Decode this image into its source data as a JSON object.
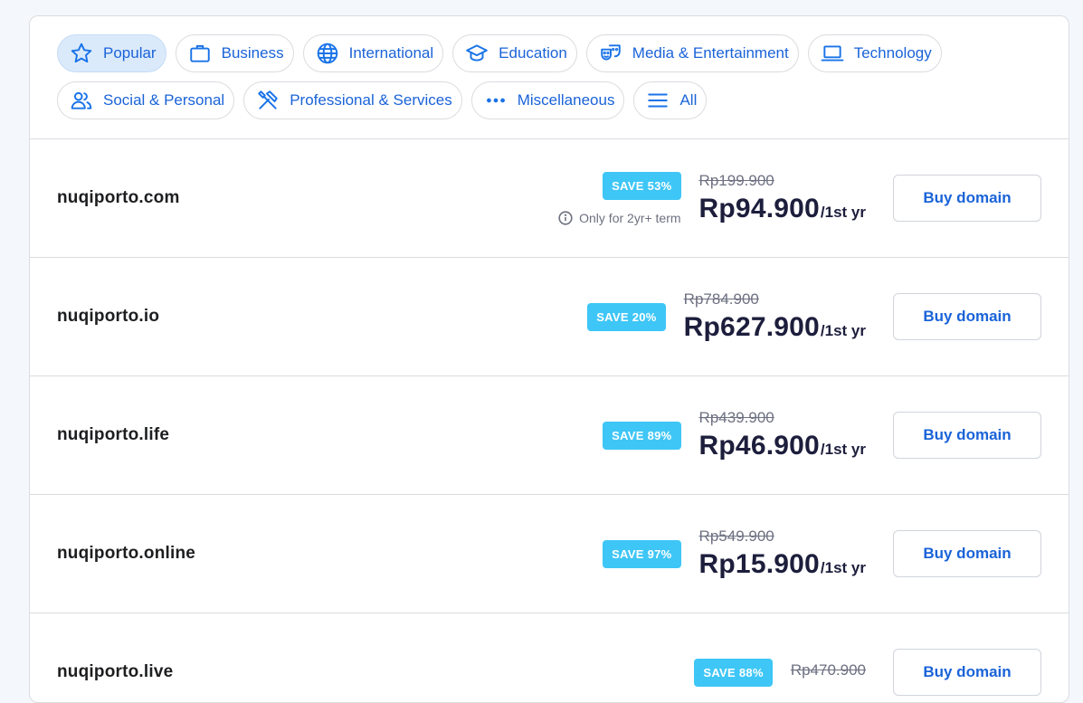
{
  "filters": {
    "row1": [
      {
        "label": "Popular",
        "icon": "star-icon",
        "active": true
      },
      {
        "label": "Business",
        "icon": "briefcase-icon",
        "active": false
      },
      {
        "label": "International",
        "icon": "globe-icon",
        "active": false
      },
      {
        "label": "Education",
        "icon": "graduation-cap-icon",
        "active": false
      },
      {
        "label": "Media & Entertainment",
        "icon": "theater-masks-icon",
        "active": false
      },
      {
        "label": "Technology",
        "icon": "laptop-icon",
        "active": false
      }
    ],
    "row2": [
      {
        "label": "Social & Personal",
        "icon": "users-icon",
        "active": false
      },
      {
        "label": "Professional & Services",
        "icon": "tools-icon",
        "active": false
      },
      {
        "label": "Miscellaneous",
        "icon": "more-dots-icon",
        "active": false
      },
      {
        "label": "All",
        "icon": "menu-lines-icon",
        "active": false
      }
    ]
  },
  "domains": [
    {
      "name": "nuqiporto.com",
      "save": "SAVE 53%",
      "note": "Only for 2yr+ term",
      "old_price": "Rp199.900",
      "new_price": "Rp94.900",
      "period": "/1st yr",
      "button": "Buy domain"
    },
    {
      "name": "nuqiporto.io",
      "save": "SAVE 20%",
      "note": "",
      "old_price": "Rp784.900",
      "new_price": "Rp627.900",
      "period": "/1st yr",
      "button": "Buy domain"
    },
    {
      "name": "nuqiporto.life",
      "save": "SAVE 89%",
      "note": "",
      "old_price": "Rp439.900",
      "new_price": "Rp46.900",
      "period": "/1st yr",
      "button": "Buy domain"
    },
    {
      "name": "nuqiporto.online",
      "save": "SAVE 97%",
      "note": "",
      "old_price": "Rp549.900",
      "new_price": "Rp15.900",
      "period": "/1st yr",
      "button": "Buy domain"
    },
    {
      "name": "nuqiporto.live",
      "save": "SAVE 88%",
      "note": "",
      "old_price": "Rp470.900",
      "new_price": "",
      "period": "",
      "button": "Buy domain"
    }
  ],
  "colors": {
    "accent": "#1a63d8",
    "badge": "#3ec6f6",
    "chip_active_bg": "#dbeafb"
  }
}
